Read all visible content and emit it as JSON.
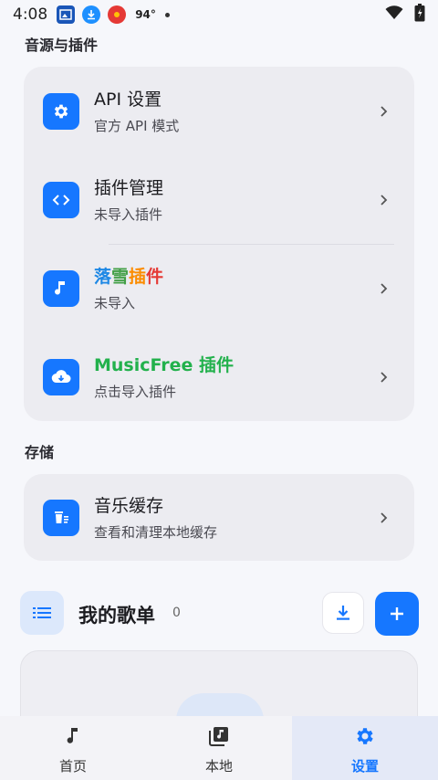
{
  "status_bar": {
    "time": "4:08",
    "temperature": "94°"
  },
  "sections": {
    "sources_title": "音源与插件",
    "storage_title": "存储"
  },
  "rows": {
    "api": {
      "title": "API 设置",
      "subtitle": "官方 API 模式",
      "icon": "gear-icon"
    },
    "plugins": {
      "title": "插件管理",
      "subtitle": "未导入插件",
      "icon": "code-icon"
    },
    "luoxue": {
      "title_chars": [
        "落",
        "雪",
        "插",
        "件"
      ],
      "subtitle": "未导入",
      "icon": "music-note-icon"
    },
    "musicfree": {
      "title": "MusicFree 插件",
      "subtitle": "点击导入插件",
      "icon": "cloud-download-icon"
    },
    "cache": {
      "title": "音乐缓存",
      "subtitle": "查看和清理本地缓存",
      "icon": "trash-icon"
    }
  },
  "playlist": {
    "title": "我的歌单",
    "count": "0"
  },
  "bottom_nav": {
    "items": [
      {
        "label": "首页",
        "icon": "music-note-icon",
        "active": false
      },
      {
        "label": "本地",
        "icon": "library-icon",
        "active": false
      },
      {
        "label": "设置",
        "icon": "gear-icon",
        "active": true
      }
    ]
  },
  "colors": {
    "accent": "#1677ff",
    "musicfree_green": "#22b14c"
  }
}
